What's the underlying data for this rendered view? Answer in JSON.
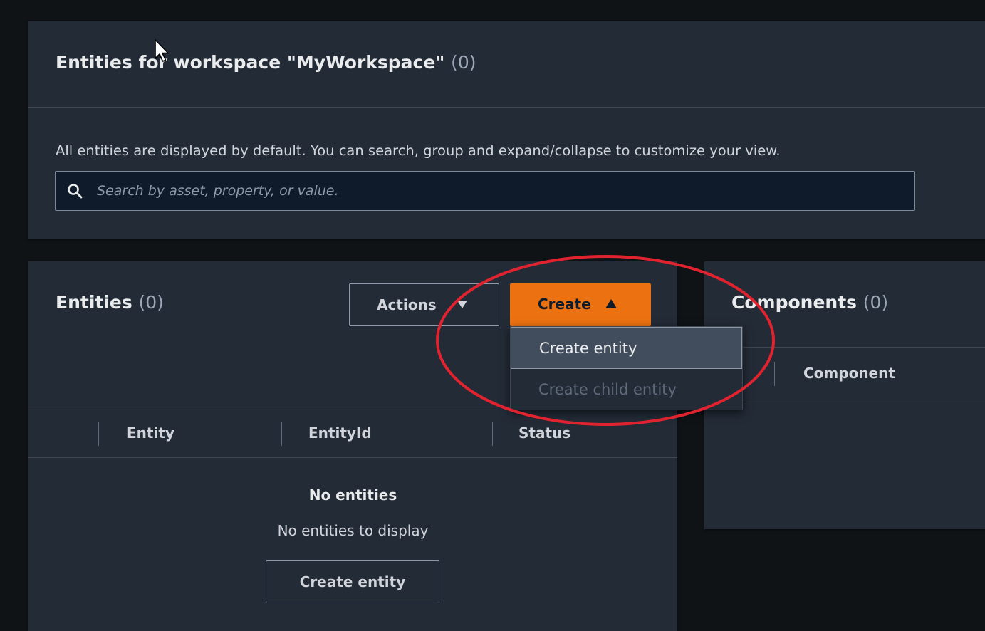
{
  "workspace_panel": {
    "title": "Entities for workspace \"MyWorkspace\"",
    "count": "(0)",
    "description": "All entities are displayed by default. You can search, group and expand/collapse to customize your view.",
    "search_placeholder": "Search by asset, property, or value."
  },
  "entities_panel": {
    "title": "Entities",
    "count": "(0)",
    "actions_label": "Actions",
    "create_label": "Create",
    "columns": [
      "Entity",
      "EntityId",
      "Status"
    ],
    "empty_title": "No entities",
    "empty_subtitle": "No entities to display",
    "empty_button_label": "Create entity"
  },
  "create_dropdown": {
    "items": [
      {
        "label": "Create entity",
        "state": "highlighted"
      },
      {
        "label": "Create child entity",
        "state": "disabled"
      }
    ]
  },
  "components_panel": {
    "title": "Components",
    "count": "(0)",
    "columns": [
      "Component"
    ]
  },
  "colors": {
    "background": "#0f1316",
    "panel": "#232b37",
    "accent_orange": "#ec7211",
    "annotation_red": "#e0232f"
  },
  "icons": [
    "search-icon",
    "caret-down-icon",
    "caret-up-icon",
    "mouse-cursor-icon"
  ]
}
